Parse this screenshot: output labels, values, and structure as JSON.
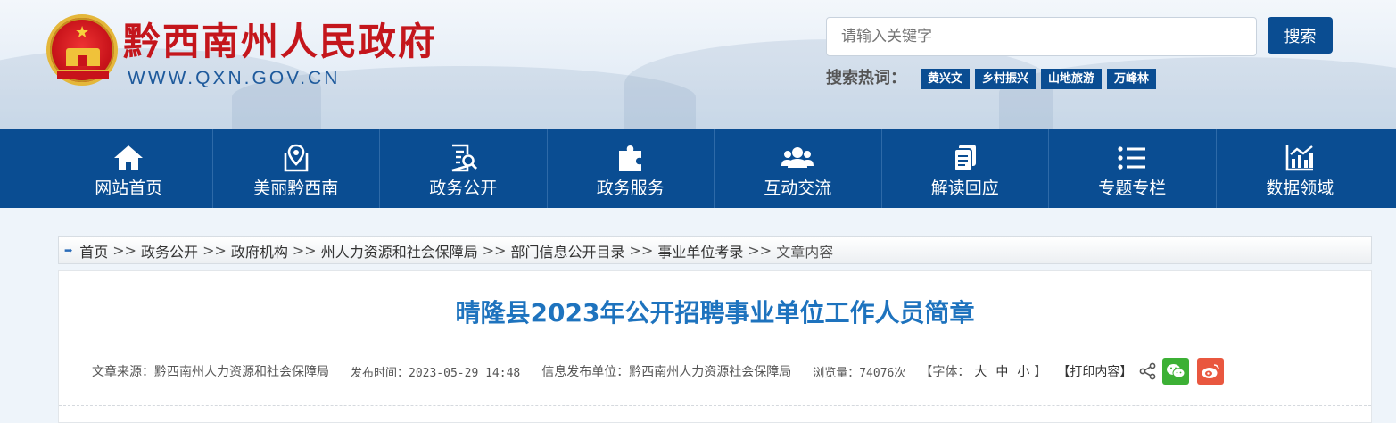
{
  "header": {
    "site_title": "黔西南州人民政府",
    "site_domain": "WWW.QXN.GOV.CN",
    "search": {
      "placeholder": "请输入关键字",
      "button_label": "搜索"
    },
    "hot_label": "搜索热词：",
    "hot_tags": [
      "黄兴文",
      "乡村振兴",
      "山地旅游",
      "万峰林"
    ]
  },
  "nav": {
    "items": [
      {
        "label": "网站首页",
        "icon": "home-icon"
      },
      {
        "label": "美丽黔西南",
        "icon": "map-pin-icon"
      },
      {
        "label": "政务公开",
        "icon": "document-search-icon"
      },
      {
        "label": "政务服务",
        "icon": "puzzle-icon"
      },
      {
        "label": "互动交流",
        "icon": "people-icon"
      },
      {
        "label": "解读回应",
        "icon": "copy-document-icon"
      },
      {
        "label": "专题专栏",
        "icon": "list-icon"
      },
      {
        "label": "数据领域",
        "icon": "chart-icon"
      }
    ]
  },
  "breadcrumb": {
    "items": [
      "首页",
      "政务公开",
      "政府机构",
      "州人力资源和社会保障局",
      "部门信息公开目录",
      "事业单位考录"
    ],
    "separator": ">>",
    "current": "文章内容"
  },
  "article": {
    "title": "晴隆县2023年公开招聘事业单位工作人员简章",
    "source": "文章来源：黔西南州人力资源和社会保障局",
    "publish_time": "发布时间：2023-05-29 14:48",
    "publisher": "信息发布单位：黔西南州人力资源社会保障局",
    "views": "浏览量：74076次",
    "font_size_label": "【字体：",
    "font_size_large": "大",
    "font_size_medium": "中",
    "font_size_small": "小",
    "font_size_close": "】",
    "print_label": "【打印内容】"
  },
  "colors": {
    "nav_bg": "#0a4d92",
    "title_red": "#c4161c",
    "article_title": "#1e73be",
    "wechat": "#3cb035",
    "weibo": "#e9573f"
  }
}
